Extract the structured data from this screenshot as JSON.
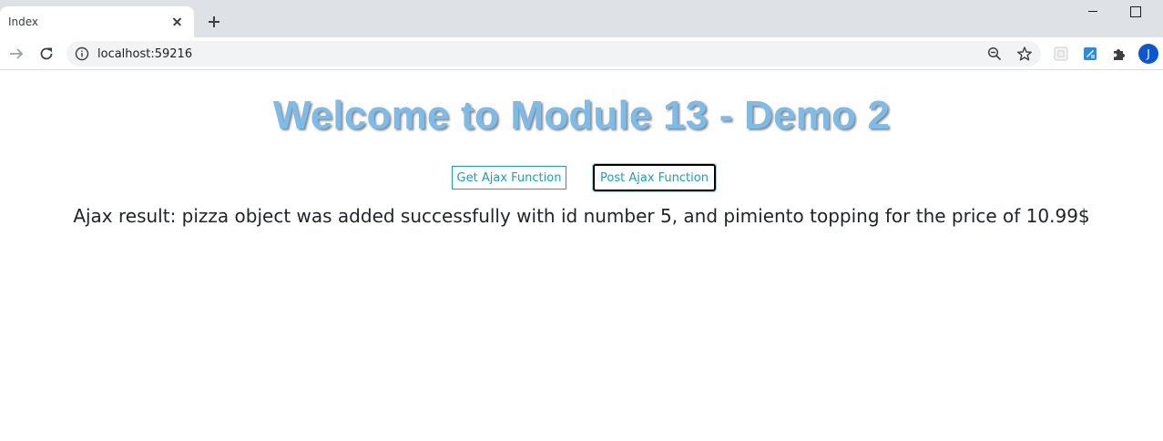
{
  "browser": {
    "tab": {
      "title": "Index"
    },
    "address_bar": {
      "url": "localhost:59216"
    },
    "profile_initial": "J"
  },
  "page": {
    "heading": "Welcome to Module 13 - Demo 2",
    "buttons": {
      "get_label": "Get Ajax Function",
      "post_label": "Post Ajax Function"
    },
    "result_text": "Ajax result: pizza object was added successfully with id number 5, and pimiento topping for the price of 10.99$"
  },
  "colors": {
    "heading": "#7bbcea",
    "button_accent": "#17a2b8",
    "tabstrip_bg": "#dee1e6",
    "avatar_bg": "#0b57d0"
  },
  "icons": [
    "close-icon",
    "plus-icon",
    "minimize-icon",
    "maximize-icon",
    "forward-arrow-icon",
    "reload-icon",
    "info-icon",
    "zoom-out-icon",
    "star-icon",
    "extension-icon",
    "puzzle-icon",
    "avatar"
  ]
}
